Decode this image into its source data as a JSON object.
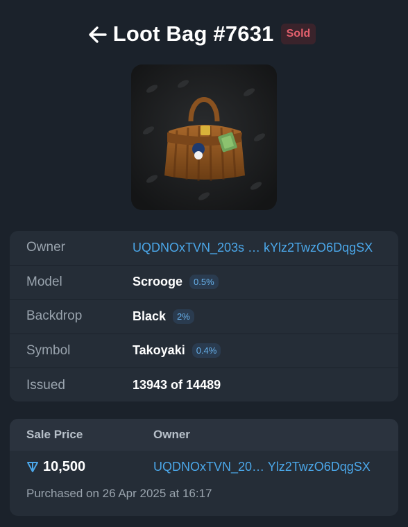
{
  "header": {
    "title": "Loot Bag #7631",
    "status": "Sold"
  },
  "icons": {
    "back": "arrow-left-icon",
    "currency": "ton-diamond-icon"
  },
  "colors": {
    "accent": "#4ba7e9",
    "sold": "#e4606d",
    "background": "#1b222b",
    "card": "#252d37"
  },
  "info": {
    "owner": {
      "label": "Owner",
      "value": "UQDNOxTVN_203s … kYlz2TwzO6DqgSX"
    },
    "model": {
      "label": "Model",
      "value": "Scrooge",
      "pct": "0.5%"
    },
    "backdrop": {
      "label": "Backdrop",
      "value": "Black",
      "pct": "2%"
    },
    "symbol": {
      "label": "Symbol",
      "value": "Takoyaki",
      "pct": "0.4%"
    },
    "issued": {
      "label": "Issued",
      "value": "13943 of 14489"
    }
  },
  "sale": {
    "price_header": "Sale Price",
    "owner_header": "Owner",
    "price": "10,500",
    "owner": "UQDNOxTVN_20… Ylz2TwzO6DqgSX",
    "purchased": "Purchased on 26 Apr 2025 at 16:17"
  }
}
